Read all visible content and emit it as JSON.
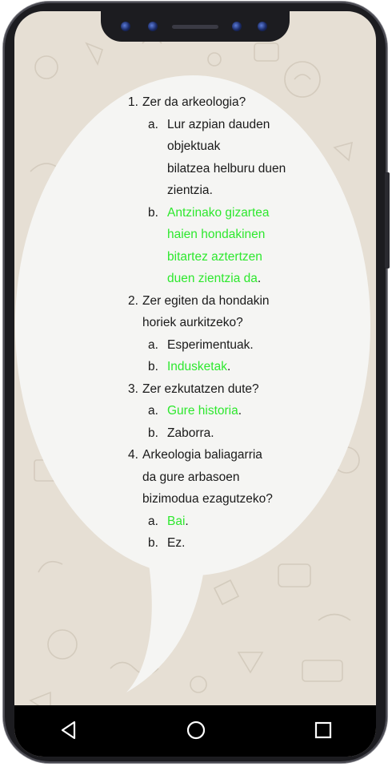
{
  "quiz": [
    {
      "number": "1.",
      "question": "Zer da arkeologia?",
      "options": [
        {
          "letter": "a.",
          "text": "Lur azpian dauden\nobjektuak\nbilatzea helburu duen\nzientzia",
          "end": ".",
          "correct": false
        },
        {
          "letter": "b.",
          "text": "Antzinako gizartea\nhaien hondakinen\nbitartez aztertzen\nduen zientzia da",
          "end": ".",
          "correct": true
        }
      ]
    },
    {
      "number": "2.",
      "question": "Zer egiten da hondakin\nhoriek aurkitzeko?",
      "options": [
        {
          "letter": "a.",
          "text": "Esperimentuak",
          "end": ".",
          "correct": false
        },
        {
          "letter": "b.",
          "text": "Indusketak",
          "end": ".",
          "correct": true
        }
      ]
    },
    {
      "number": "3.",
      "question": "Zer ezkutatzen dute?",
      "options": [
        {
          "letter": "a.",
          "text": "Gure historia",
          "end": ".",
          "correct": true
        },
        {
          "letter": "b.",
          "text": "Zaborra",
          "end": ".",
          "correct": false
        }
      ]
    },
    {
      "number": "4.",
      "question": "Arkeologia baliagarria\nda gure arbasoen\nbizimodua ezagutzeko?",
      "options": [
        {
          "letter": "a.",
          "text": "Bai",
          "end": ".",
          "correct": true
        },
        {
          "letter": "b.",
          "text": "Ez",
          "end": ".",
          "correct": false
        }
      ]
    }
  ],
  "colors": {
    "correct": "#2ee82e",
    "text": "#1a1a1a",
    "bubble": "#f5f5f3",
    "wallpaper": "#e6dfd4"
  },
  "icons": {
    "nav_back": "back-triangle-icon",
    "nav_home": "home-circle-icon",
    "nav_recents": "recents-square-icon"
  }
}
